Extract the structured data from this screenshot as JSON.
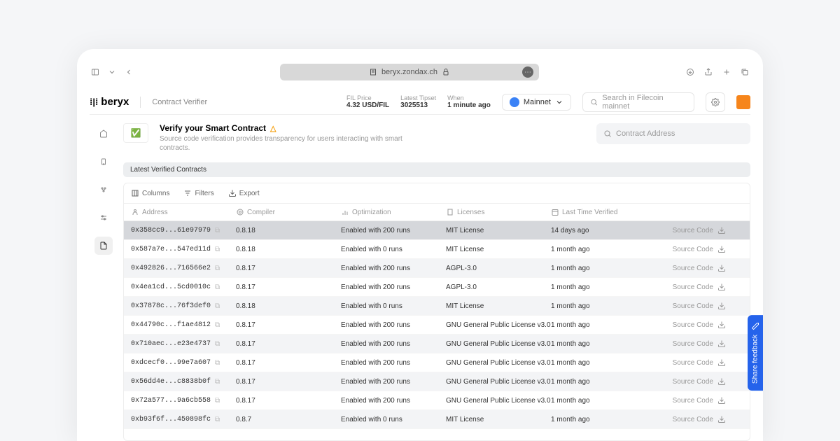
{
  "browser": {
    "url": "beryx.zondax.ch"
  },
  "header": {
    "logo": "beryx",
    "page": "Contract Verifier",
    "stats": {
      "price_label": "FIL Price",
      "price_value": "4.32 USD/FIL",
      "tipset_label": "Latest Tipset",
      "tipset_value": "3025513",
      "when_label": "When",
      "when_value": "1 minute ago"
    },
    "network": "Mainnet",
    "search_placeholder": "Search in Filecoin mainnet"
  },
  "banner": {
    "title": "Verify your Smart Contract",
    "desc": "Source code verification provides transparency for users interacting with smart contracts.",
    "search_placeholder": "Contract Address"
  },
  "tab": "Latest Verified Contracts",
  "toolbar": {
    "columns": "Columns",
    "filters": "Filters",
    "export": "Export"
  },
  "columns": {
    "address": "Address",
    "compiler": "Compiler",
    "optimization": "Optimization",
    "licenses": "Licenses",
    "last": "Last Time Verified"
  },
  "source_label": "Source Code",
  "feedback": "Share feedback",
  "rows": [
    {
      "addr": "0x358cc9...61e97979",
      "compiler": "0.8.18",
      "opt": "Enabled with 200 runs",
      "lic": "MIT License",
      "time": "14 days ago",
      "hl": true
    },
    {
      "addr": "0x587a7e...547ed11d",
      "compiler": "0.8.18",
      "opt": "Enabled with 0 runs",
      "lic": "MIT License",
      "time": "1 month ago"
    },
    {
      "addr": "0x492826...716566e2",
      "compiler": "0.8.17",
      "opt": "Enabled with 200 runs",
      "lic": "AGPL-3.0",
      "time": "1 month ago"
    },
    {
      "addr": "0x4ea1cd...5cd0010c",
      "compiler": "0.8.17",
      "opt": "Enabled with 200 runs",
      "lic": "AGPL-3.0",
      "time": "1 month ago"
    },
    {
      "addr": "0x37878c...76f3def0",
      "compiler": "0.8.18",
      "opt": "Enabled with 0 runs",
      "lic": "MIT License",
      "time": "1 month ago"
    },
    {
      "addr": "0x44790c...f1ae4812",
      "compiler": "0.8.17",
      "opt": "Enabled with 200 runs",
      "lic": "GNU General Public License v3.0",
      "time": "1 month ago"
    },
    {
      "addr": "0x710aec...e23e4737",
      "compiler": "0.8.17",
      "opt": "Enabled with 200 runs",
      "lic": "GNU General Public License v3.0",
      "time": "1 month ago"
    },
    {
      "addr": "0xdcecf0...99e7a607",
      "compiler": "0.8.17",
      "opt": "Enabled with 200 runs",
      "lic": "GNU General Public License v3.0",
      "time": "1 month ago"
    },
    {
      "addr": "0x56dd4e...c8838b0f",
      "compiler": "0.8.17",
      "opt": "Enabled with 200 runs",
      "lic": "GNU General Public License v3.0",
      "time": "1 month ago"
    },
    {
      "addr": "0x72a577...9a6cb558",
      "compiler": "0.8.17",
      "opt": "Enabled with 200 runs",
      "lic": "GNU General Public License v3.0",
      "time": "1 month ago"
    },
    {
      "addr": "0xb93f6f...450898fc",
      "compiler": "0.8.7",
      "opt": "Enabled with 0 runs",
      "lic": "MIT License",
      "time": "1 month ago"
    }
  ]
}
